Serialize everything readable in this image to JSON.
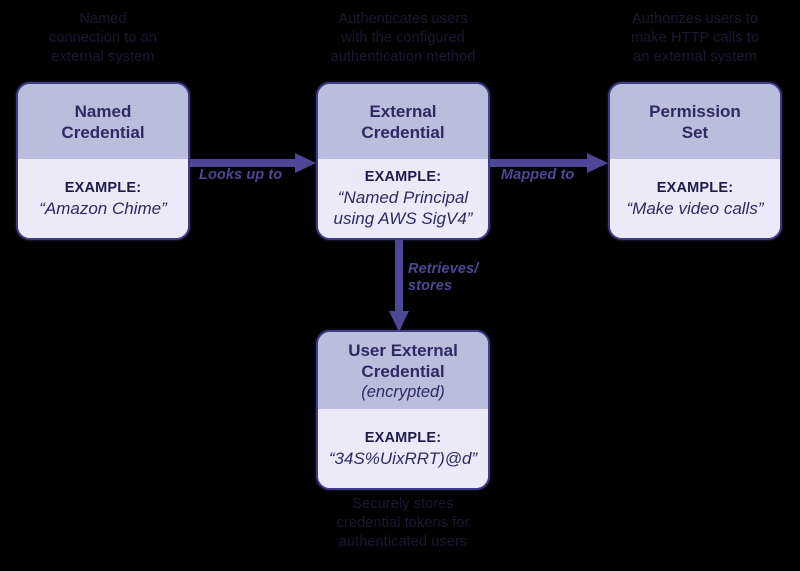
{
  "diagram": {
    "title": "Salesforce Named Credential authentication flow",
    "background_color": "#000000",
    "box_border_color": "#413a87",
    "box_header_color": "#b9bedd",
    "box_body_color": "#eceaf8",
    "connector_color": "#4d4796",
    "caption_color": "#191930"
  },
  "nodes": {
    "named_credential": {
      "title": "Named\nCredential",
      "example_label": "EXAMPLE:",
      "example_value": "“Amazon Chime”",
      "caption": "Named\nconnection to an\nexternal system"
    },
    "external_credential": {
      "title": "External\nCredential",
      "example_label": "EXAMPLE:",
      "example_value": "“Named Principal\nusing AWS SigV4”",
      "caption": "Authenticates users\nwith the configured\nauthentication method"
    },
    "permission_set": {
      "title": "Permission\nSet",
      "example_label": "EXAMPLE:",
      "example_value": "“Make video calls”",
      "caption": "Authorizes users to\nmake HTTP calls to\nan external system"
    },
    "user_external_credential": {
      "title": "User External\nCredential",
      "subtitle": "(encrypted)",
      "example_label": "EXAMPLE:",
      "example_value": "“34S%UixRRT)@d”",
      "caption": "Securely stores\ncredential tokens for\nauthenticated users"
    }
  },
  "connectors": {
    "looks_up_to": "Looks up to",
    "mapped_to": "Mapped to",
    "retrieves_stores": "Retrieves/\nstores"
  }
}
